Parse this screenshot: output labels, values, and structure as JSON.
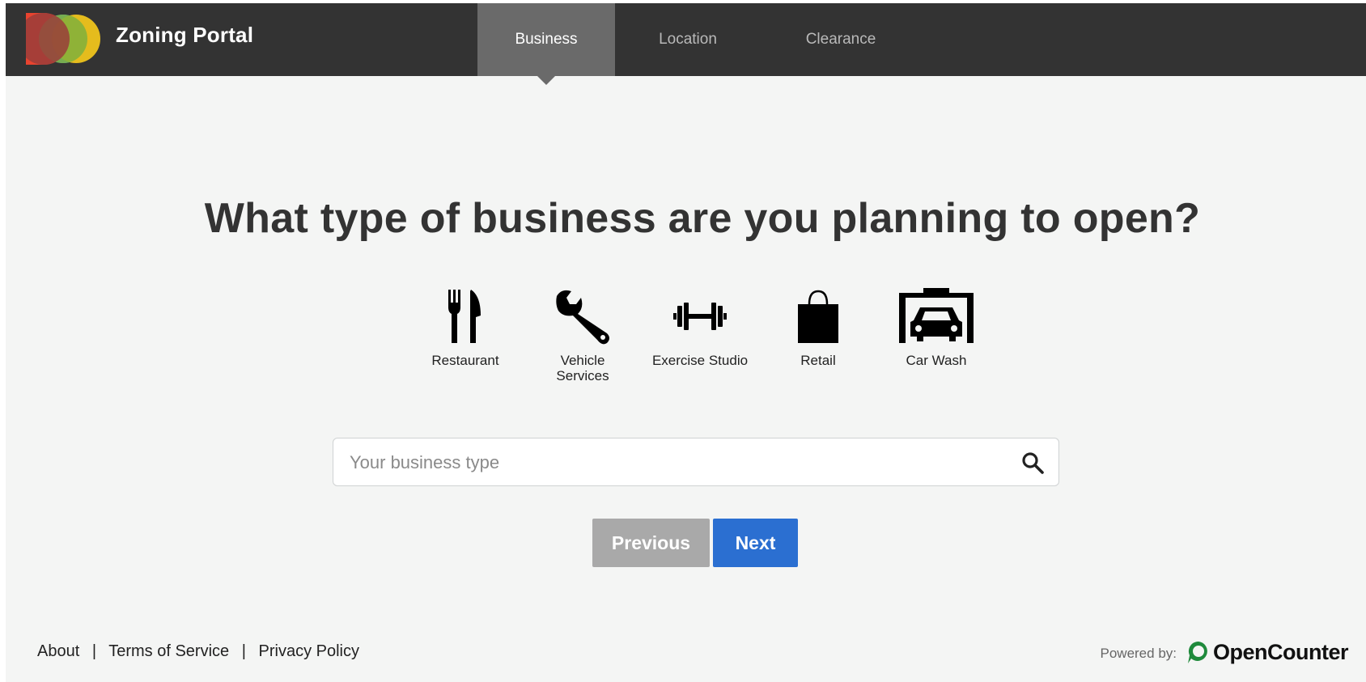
{
  "header": {
    "brand": "Zoning Portal",
    "tabs": [
      {
        "label": "Business",
        "active": true
      },
      {
        "label": "Location",
        "active": false
      },
      {
        "label": "Clearance",
        "active": false
      }
    ]
  },
  "main": {
    "heading": "What type of business are you planning to open?",
    "categories": [
      {
        "label": "Restaurant",
        "icon": "fork-knife-icon"
      },
      {
        "label": "Vehicle Services",
        "icon": "wrench-icon"
      },
      {
        "label": "Exercise Studio",
        "icon": "dumbbell-icon"
      },
      {
        "label": "Retail",
        "icon": "shopping-bag-icon"
      },
      {
        "label": "Car Wash",
        "icon": "car-wash-icon"
      }
    ],
    "search": {
      "placeholder": "Your business type",
      "value": ""
    },
    "buttons": {
      "previous": "Previous",
      "next": "Next"
    }
  },
  "footer": {
    "links": [
      "About",
      "Terms of Service",
      "Privacy Policy"
    ],
    "powered_by_label": "Powered by:",
    "powered_by_brand": "OpenCounter"
  },
  "colors": {
    "header_bg": "#333333",
    "active_tab_bg": "#6a6a6a",
    "page_bg": "#f4f5f4",
    "next_button": "#2b6fd1",
    "previous_button": "#a9a9a9",
    "opencounter_green": "#1f8a3c"
  }
}
